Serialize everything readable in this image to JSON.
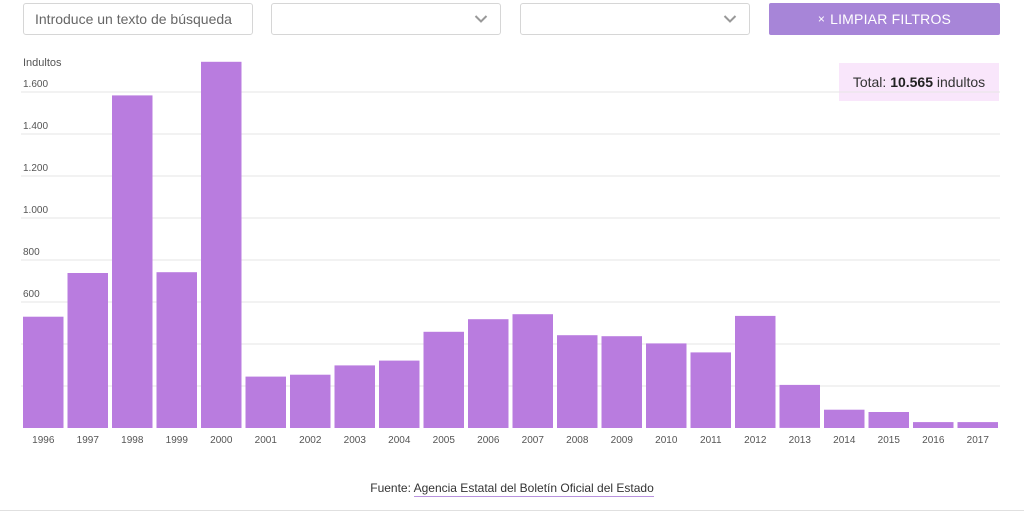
{
  "filters": {
    "search_placeholder": "Introduce un texto de búsqueda",
    "select_1_value": "",
    "select_2_value": "",
    "clear_label": "LIMPIAR FILTROS",
    "clear_icon": "×"
  },
  "total": {
    "prefix": "Total:",
    "value": "10.565",
    "suffix": "indultos"
  },
  "source": {
    "label": "Fuente:",
    "link_text": "Agencia Estatal del Boletín Oficial del Estado"
  },
  "colors": {
    "bar": "#b97cdf",
    "accent": "#a785d8",
    "badge_bg": "#f9e6fb",
    "grid": "#e6e6e6"
  },
  "chart_data": {
    "type": "bar",
    "ylabel": "Indultos",
    "ylim": [
      0,
      1800
    ],
    "yticks": [
      600,
      800,
      1000,
      1200,
      1400,
      1600
    ],
    "ytick_labels": [
      "600",
      "800",
      "1.000",
      "1.200",
      "1.400",
      "1.600"
    ],
    "gridlines": [
      200,
      400,
      600,
      800,
      1000,
      1200,
      1400,
      1600
    ],
    "grid": true,
    "categories": [
      "1996",
      "1997",
      "1998",
      "1999",
      "2000",
      "2001",
      "2002",
      "2003",
      "2004",
      "2005",
      "2006",
      "2007",
      "2008",
      "2009",
      "2010",
      "2011",
      "2012",
      "2013",
      "2014",
      "2015",
      "2016",
      "2017"
    ],
    "values": [
      530,
      738,
      1584,
      742,
      1744,
      245,
      254,
      298,
      321,
      458,
      518,
      542,
      442,
      437,
      403,
      360,
      534,
      205,
      87,
      76,
      28,
      28
    ]
  }
}
